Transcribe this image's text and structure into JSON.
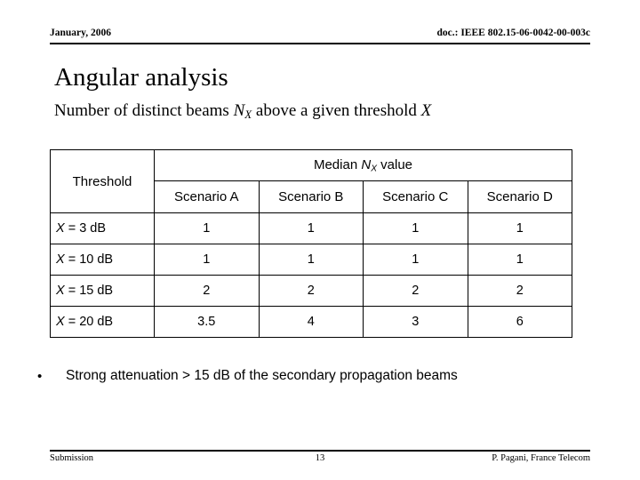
{
  "header": {
    "left": "January, 2006",
    "right": "doc.: IEEE 802.15-06-0042-00-003c"
  },
  "title": "Angular analysis",
  "subtitle": {
    "prefix": "Number of distinct beams ",
    "symbol": "N",
    "subscript": "X",
    "middle": " above a given threshold ",
    "suffix": "X"
  },
  "table": {
    "threshold_header": "Threshold",
    "median_header": {
      "prefix": "Median ",
      "symbol": "N",
      "subscript": "X",
      "suffix": " value"
    },
    "scenarios": [
      "Scenario A",
      "Scenario B",
      "Scenario C",
      "Scenario D"
    ],
    "rows": [
      {
        "label_symbol": "X",
        "label_text": " = 3 dB",
        "values": [
          "1",
          "1",
          "1",
          "1"
        ]
      },
      {
        "label_symbol": "X",
        "label_text": " = 10 dB",
        "values": [
          "1",
          "1",
          "1",
          "1"
        ]
      },
      {
        "label_symbol": "X",
        "label_text": " = 15 dB",
        "values": [
          "2",
          "2",
          "2",
          "2"
        ]
      },
      {
        "label_symbol": "X",
        "label_text": " = 20 dB",
        "values": [
          "3.5",
          "4",
          "3",
          "6"
        ]
      }
    ]
  },
  "bullet": {
    "marker": "•",
    "text": "Strong attenuation > 15 dB of the secondary propagation beams"
  },
  "footer": {
    "left": "Submission",
    "page": "13",
    "right": "P. Pagani, France Telecom"
  },
  "chart_data": {
    "type": "table",
    "title": "Median N_X value by threshold and scenario",
    "categories": [
      "Scenario A",
      "Scenario B",
      "Scenario C",
      "Scenario D"
    ],
    "row_labels": [
      "X = 3 dB",
      "X = 10 dB",
      "X = 15 dB",
      "X = 20 dB"
    ],
    "series": [
      {
        "name": "X = 3 dB",
        "values": [
          1,
          1,
          1,
          1
        ]
      },
      {
        "name": "X = 10 dB",
        "values": [
          1,
          1,
          1,
          1
        ]
      },
      {
        "name": "X = 15 dB",
        "values": [
          2,
          2,
          2,
          2
        ]
      },
      {
        "name": "X = 20 dB",
        "values": [
          3.5,
          4,
          3,
          6
        ]
      }
    ],
    "xlabel": "Scenario",
    "ylabel": "Median N_X"
  }
}
